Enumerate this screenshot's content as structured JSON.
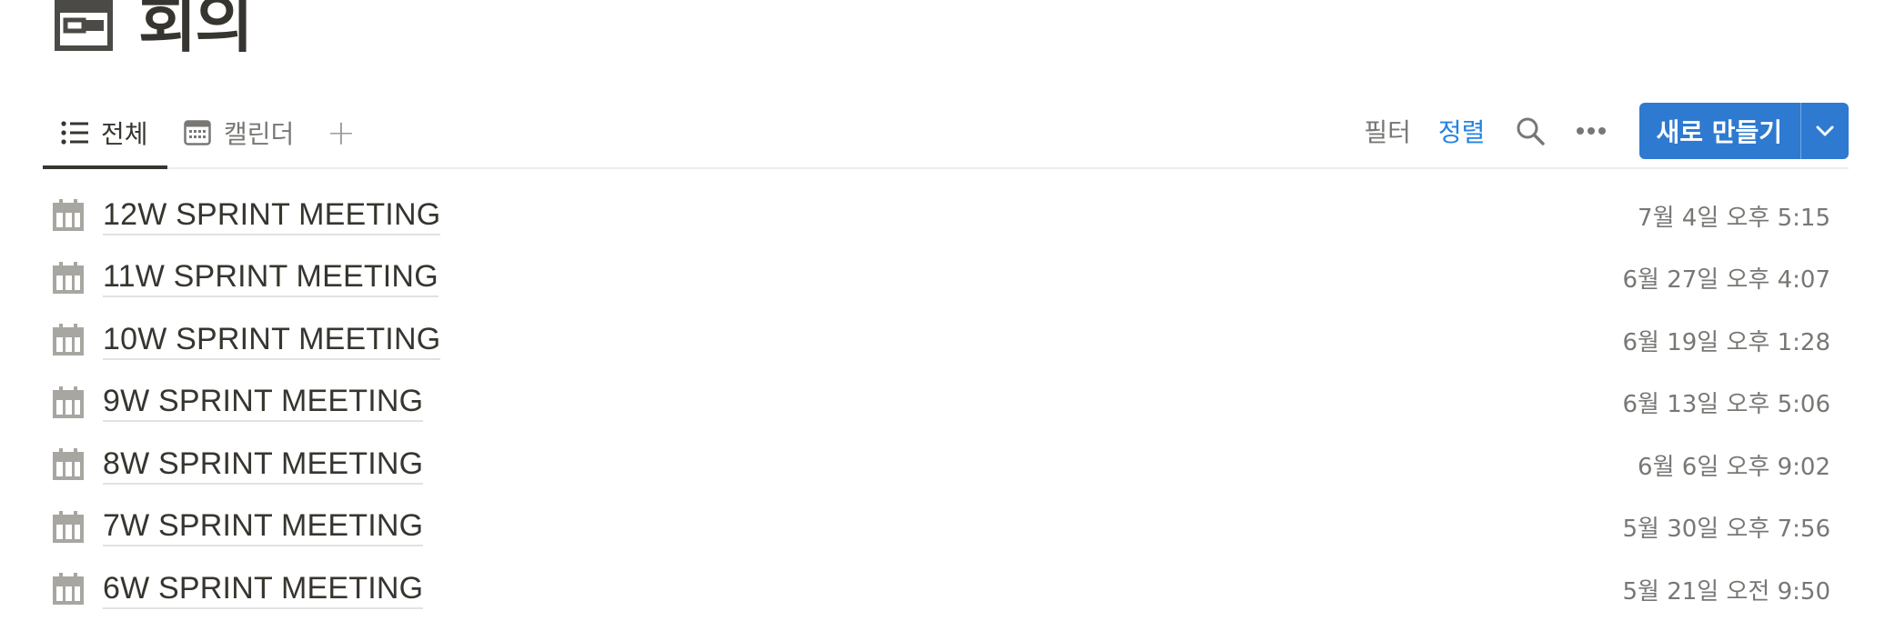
{
  "page": {
    "title": "회의",
    "icon": "calendar-page-icon"
  },
  "views": [
    {
      "label": "전체",
      "icon": "list-icon",
      "active": true
    },
    {
      "label": "캘린더",
      "icon": "calendar-icon",
      "active": false
    }
  ],
  "add_view_label": "+",
  "toolbar": {
    "filter_label": "필터",
    "sort_label": "정렬",
    "new_label": "새로 만들기"
  },
  "colors": {
    "accent": "#2383e2",
    "button": "#2e7ad1",
    "text": "#37352f",
    "muted": "#787774"
  },
  "meetings": [
    {
      "title": "12W SPRINT MEETING",
      "date": "7월 4일 오후 5:15"
    },
    {
      "title": "11W SPRINT MEETING",
      "date": "6월 27일 오후 4:07"
    },
    {
      "title": "10W SPRINT MEETING",
      "date": "6월 19일 오후 1:28"
    },
    {
      "title": "9W SPRINT MEETING",
      "date": "6월 13일 오후 5:06"
    },
    {
      "title": "8W SPRINT MEETING",
      "date": "6월 6일 오후 9:02"
    },
    {
      "title": "7W SPRINT MEETING",
      "date": "5월 30일 오후 7:56"
    },
    {
      "title": "6W SPRINT MEETING",
      "date": "5월 21일 오전 9:50"
    }
  ]
}
